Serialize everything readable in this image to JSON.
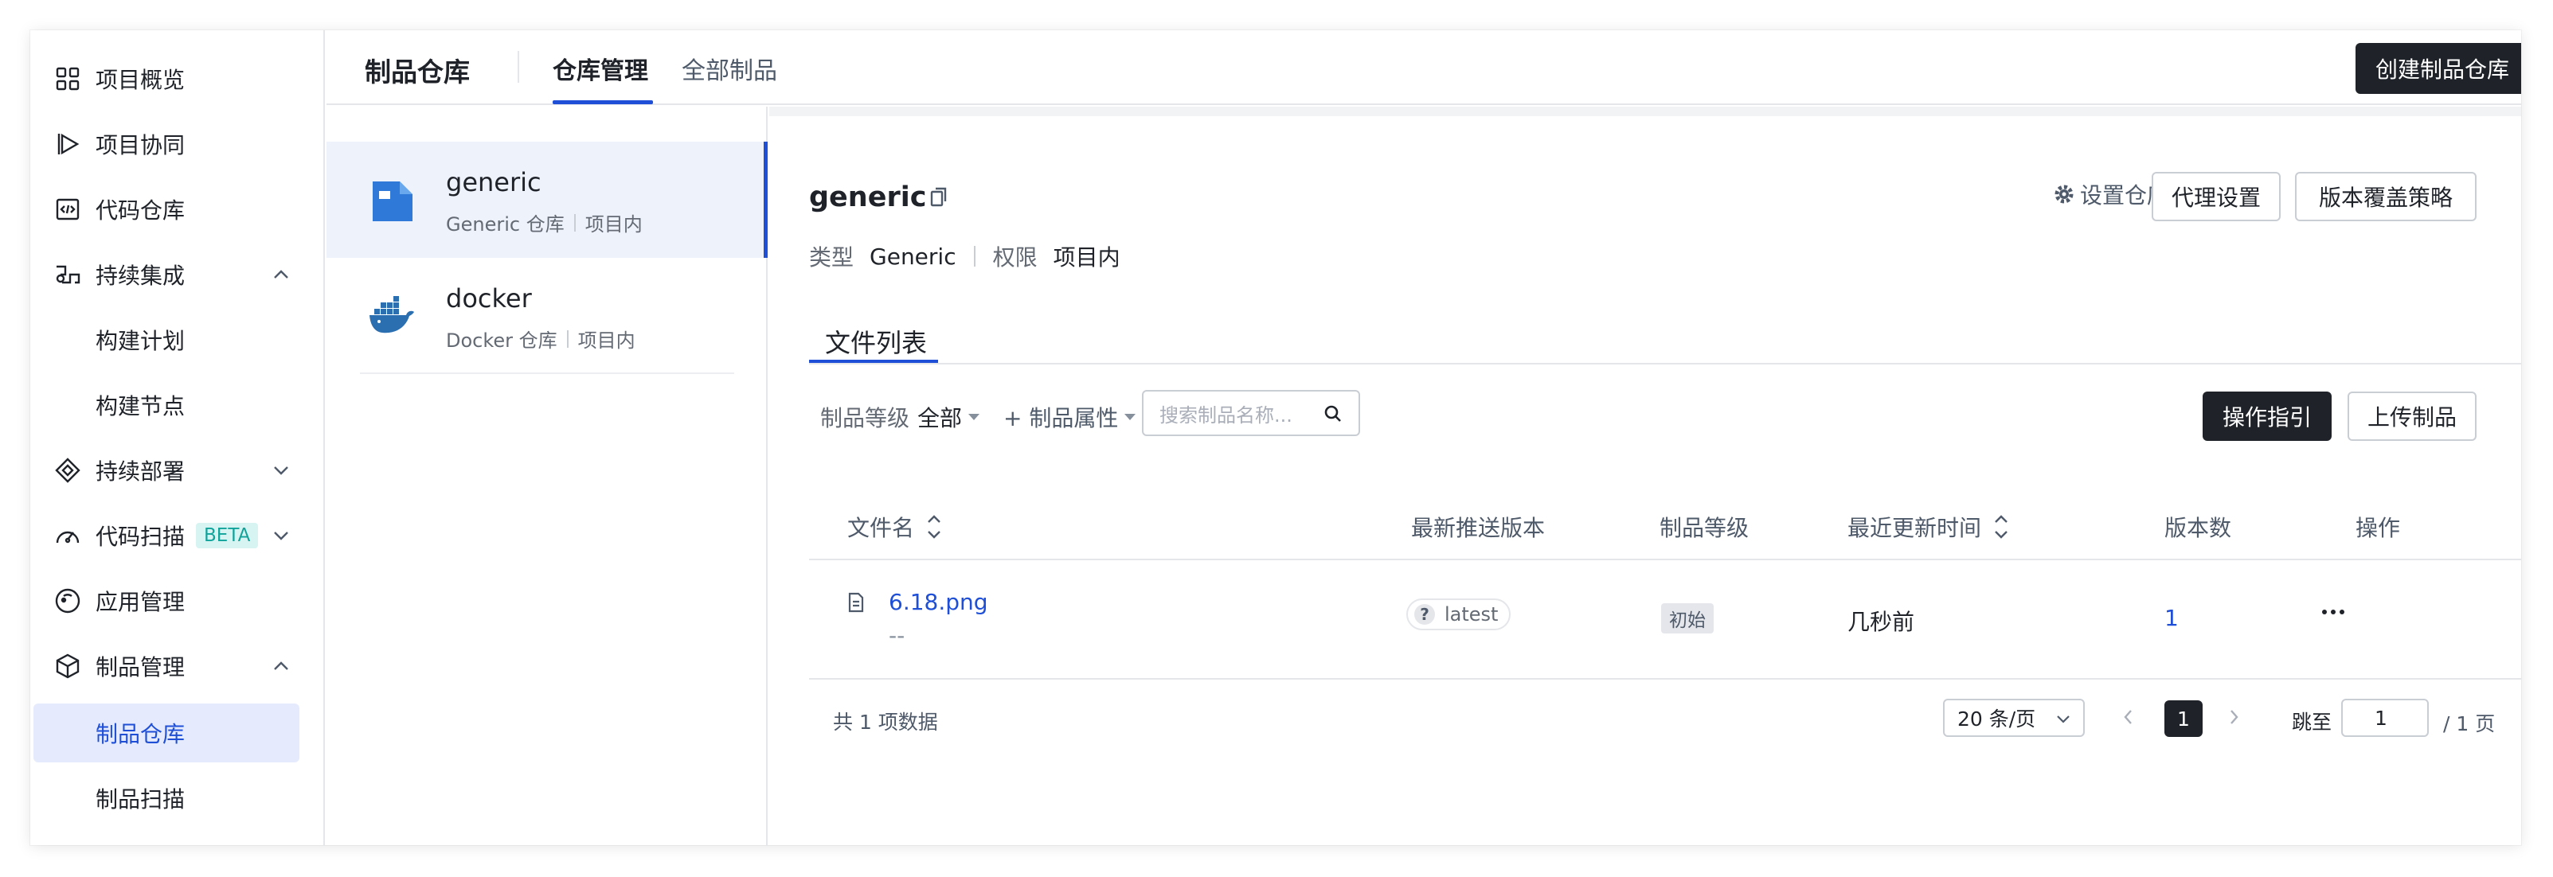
{
  "sidebar": {
    "items": [
      {
        "label": "项目概览",
        "icon": "grid-icon"
      },
      {
        "label": "项目协同",
        "icon": "play-triangle-icon"
      },
      {
        "label": "代码仓库",
        "icon": "code-window-icon"
      },
      {
        "label": "持续集成",
        "icon": "ci-icon",
        "expanded": true
      },
      {
        "label": "构建计划",
        "sub": true
      },
      {
        "label": "构建节点",
        "sub": true
      },
      {
        "label": "持续部署",
        "icon": "deploy-icon",
        "expanded": false
      },
      {
        "label": "代码扫描",
        "icon": "gauge-icon",
        "badge": "BETA",
        "expanded": false
      },
      {
        "label": "应用管理",
        "icon": "app-circle-icon"
      },
      {
        "label": "制品管理",
        "icon": "cube-icon",
        "expanded": true
      },
      {
        "label": "制品仓库",
        "sub": true,
        "active": true
      },
      {
        "label": "制品扫描",
        "sub": true
      }
    ]
  },
  "header": {
    "title": "制品仓库",
    "tabs": [
      {
        "label": "仓库管理",
        "active": true
      },
      {
        "label": "全部制品",
        "active": false
      }
    ],
    "create_button": "创建制品仓库"
  },
  "repos": [
    {
      "name": "generic",
      "type_label": "Generic 仓库",
      "scope": "项目内",
      "active": true
    },
    {
      "name": "docker",
      "type_label": "Docker 仓库",
      "scope": "项目内",
      "active": false
    }
  ],
  "detail": {
    "title": "generic",
    "type_key": "类型",
    "type_value": "Generic",
    "perm_key": "权限",
    "perm_value": "项目内",
    "settings_link": "设置仓库",
    "proxy_button": "代理设置",
    "policy_button": "版本覆盖策略",
    "tab": "文件列表",
    "filter_level_label": "制品等级",
    "filter_level_value": "全部",
    "filter_attr": "+ 制品属性",
    "search_placeholder": "搜索制品名称...",
    "guide_button": "操作指引",
    "upload_button": "上传制品"
  },
  "table": {
    "columns": [
      "文件名",
      "最新推送版本",
      "制品等级",
      "最近更新时间",
      "版本数",
      "操作"
    ],
    "rows": [
      {
        "name": "6.18.png",
        "desc": "--",
        "version": "latest",
        "version_badge": "?",
        "level": "初始",
        "updated": "几秒前",
        "count": "1"
      }
    ]
  },
  "pagination": {
    "total": "共 1 项数据",
    "page_size": "20 条/页",
    "current": "1",
    "jump_label": "跳至",
    "jump_value": "1",
    "total_pages": "/ 1 页"
  },
  "colors": {
    "accent": "#1e4fd6",
    "dark_button": "#1f2329",
    "active_bg": "#e5ebfd"
  }
}
